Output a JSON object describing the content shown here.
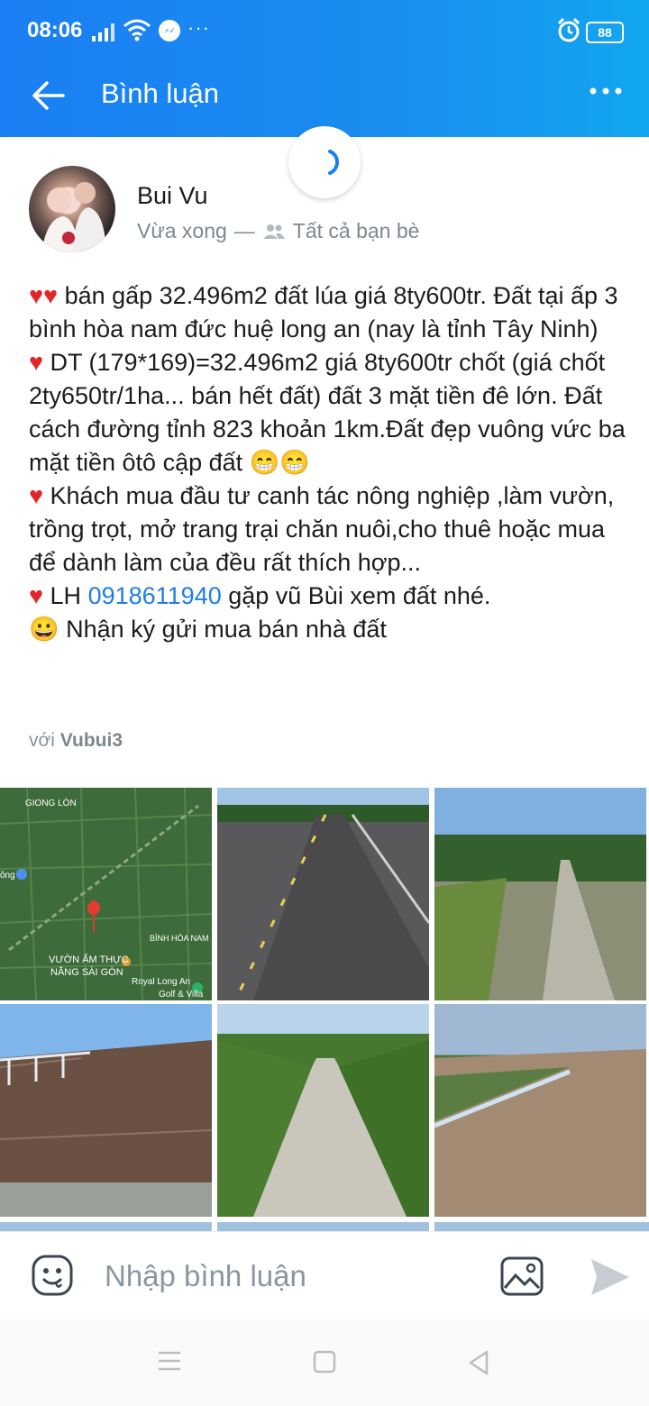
{
  "status": {
    "time": "08:06",
    "battery": "88"
  },
  "header": {
    "title": "Bình luận"
  },
  "post": {
    "author": "Bui Vu",
    "time": "Vừa xong",
    "separator": "—",
    "privacy": "Tất cả bạn bè",
    "paragraphs": [
      {
        "prefix": "♥♥",
        "text": " bán gấp 32.496m2 đất lúa giá 8ty600tr. Đất tại ấp 3 bình hòa nam đức huệ long an (nay là tỉnh Tây Ninh)"
      },
      {
        "prefix": "♥",
        "text": " DT (179*169)=32.496m2 giá 8ty600tr chốt (giá chốt 2ty650tr/1ha... bán hết đất) đất 3 mặt tiền đê lớn. Đất cách đường tỉnh 823 khoản 1km.Đất đẹp vuông vức ba mặt tiền ôtô cập đất 😁😁"
      },
      {
        "prefix": "♥",
        "text": " Khách mua đầu tư canh tác nông nghiệp ,làm vườn, trồng trọt, mở trang trại chăn nuôi,cho thuê hoặc mua để dành làm của đều rất thích hợp..."
      }
    ],
    "contact": {
      "prefix": "♥",
      "before": " LH ",
      "phone": "0918611940",
      "after": " gặp vũ Bùi xem đất nhé."
    },
    "last": {
      "emoji": "😀",
      "text": " Nhận ký gửi mua bán nhà đất"
    },
    "with_label": "với",
    "with_name": "Vubui3"
  },
  "map_labels": {
    "giong_lon": "GIONG LÒN",
    "ong": "ông",
    "binh_hoa_nam": "BÌNH HÒA NAM",
    "restaurant_1": "VƯỜN ẨM THỰC",
    "restaurant_2": "NẮNG SÀI GÒN",
    "golf_1": "Royal Long An",
    "golf_2": "Golf & Villa"
  },
  "comment": {
    "placeholder": "Nhập bình luận"
  },
  "colors": {
    "header_start": "#1a7ff4",
    "header_end": "#12a6ef",
    "link": "#1e7ee8",
    "heart": "#e02626"
  }
}
